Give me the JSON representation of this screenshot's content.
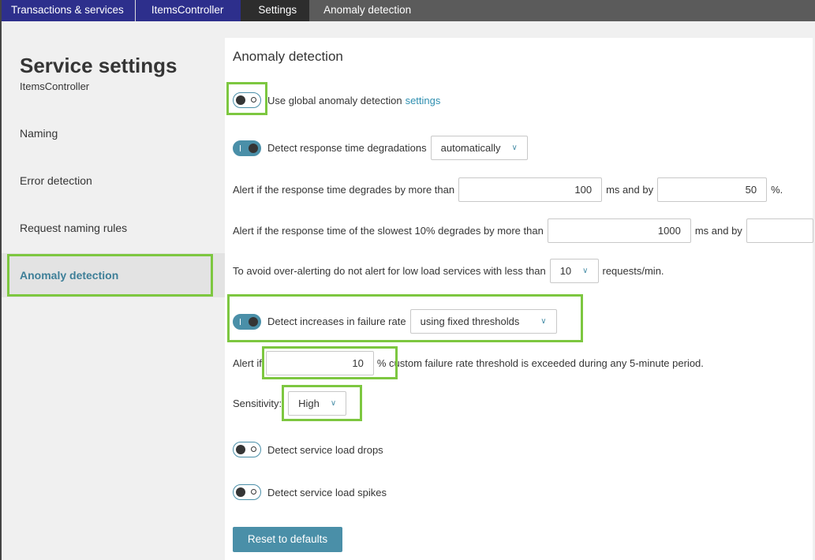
{
  "breadcrumb": [
    "Transactions & services",
    "ItemsController",
    "Settings",
    "Anomaly detection"
  ],
  "sidebar": {
    "title": "Service settings",
    "subtitle": "ItemsController",
    "items": [
      "Naming",
      "Error detection",
      "Request naming rules",
      "Anomaly detection"
    ],
    "active": "Anomaly detection"
  },
  "main": {
    "title": "Anomaly detection",
    "global": {
      "label": "Use global anomaly detection",
      "link": "settings",
      "enabled": false
    },
    "response": {
      "label": "Detect response time degradations",
      "enabled": true,
      "mode": "automatically"
    },
    "alert1": {
      "pre": "Alert if the response time degrades by more than",
      "ms": "100",
      "mid": "ms and by",
      "pct": "50",
      "post": "%."
    },
    "alert2": {
      "pre": "Alert if the response time of the slowest 10% degrades by more than",
      "ms": "1000",
      "mid": "ms and by",
      "pct": ""
    },
    "low_load": {
      "pre": "To avoid over-alerting do not alert for low load services with less than",
      "value": "10",
      "post": "requests/min."
    },
    "failure": {
      "label": "Detect increases in failure rate",
      "enabled": true,
      "mode": "using fixed thresholds"
    },
    "threshold": {
      "pre": "Alert if",
      "value": "10",
      "post": "% custom failure rate threshold is exceeded during any 5-minute period."
    },
    "sensitivity": {
      "label": "Sensitivity:",
      "value": "High"
    },
    "load_drops": {
      "label": "Detect service load drops",
      "enabled": false
    },
    "load_spikes": {
      "label": "Detect service load spikes",
      "enabled": false
    },
    "reset": "Reset to defaults"
  },
  "colors": {
    "accent": "#4a8fa8",
    "highlight": "#7dc740",
    "breadcrumb": "#2d2f8c"
  }
}
